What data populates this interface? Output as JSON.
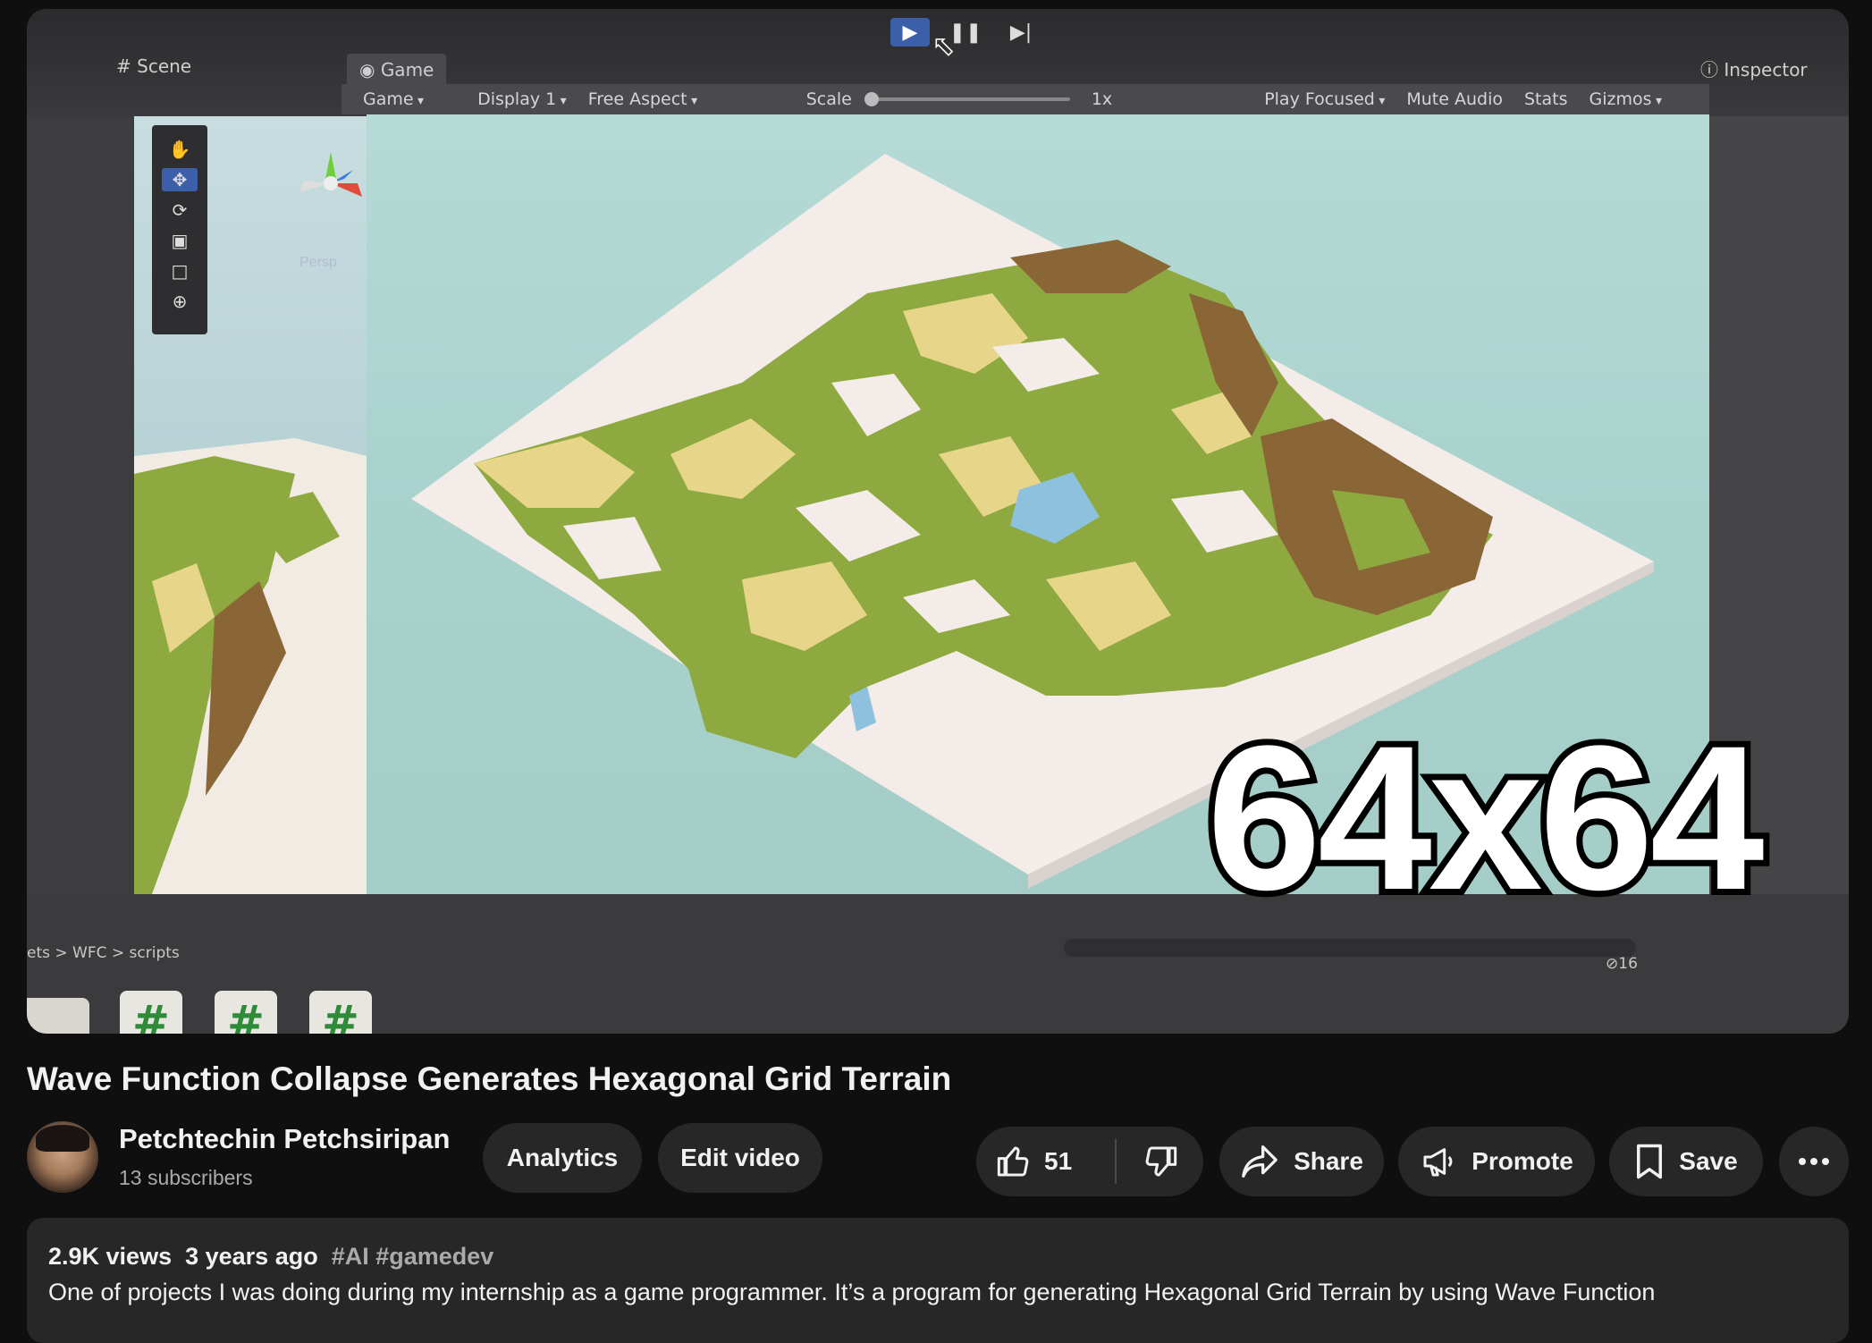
{
  "player": {
    "unity": {
      "tabs": {
        "scene": "Scene",
        "game": "Game",
        "inspector": "Inspector"
      },
      "toolbar": {
        "game": "Game",
        "display": "Display 1",
        "aspect": "Free Aspect",
        "scale_label": "Scale",
        "scale_value": "1x",
        "play_focused": "Play Focused",
        "mute_audio": "Mute Audio",
        "stats": "Stats",
        "gizmos": "Gizmos"
      },
      "persp_label": "Persp",
      "breadcrumb": "ets > WFC > scripts",
      "hidden_count": "16",
      "script_glyph": "#"
    },
    "overlay_text": "64x64",
    "colors": {
      "sky": "#a9d2cd",
      "snow": "#f3ece8",
      "sand": "#e7d58a",
      "grass": "#8ea93f",
      "dirt": "#8a6536",
      "water": "#8ec1dd"
    }
  },
  "video": {
    "title": "Wave Function Collapse Generates Hexagonal Grid Terrain"
  },
  "channel": {
    "name": "Petchtechin Petchsiripan",
    "subscribers": "13 subscribers"
  },
  "actions": {
    "analytics": "Analytics",
    "edit_video": "Edit video",
    "like_count": "51",
    "share": "Share",
    "promote": "Promote",
    "save": "Save",
    "more_icon": "more-horizontal-icon"
  },
  "description": {
    "views": "2.9K views",
    "age": "3 years ago",
    "tags": "#AI #gamedev",
    "text": "One of projects I was doing during my internship as a game programmer. It’s a program for generating Hexagonal Grid Terrain by using Wave Function"
  }
}
